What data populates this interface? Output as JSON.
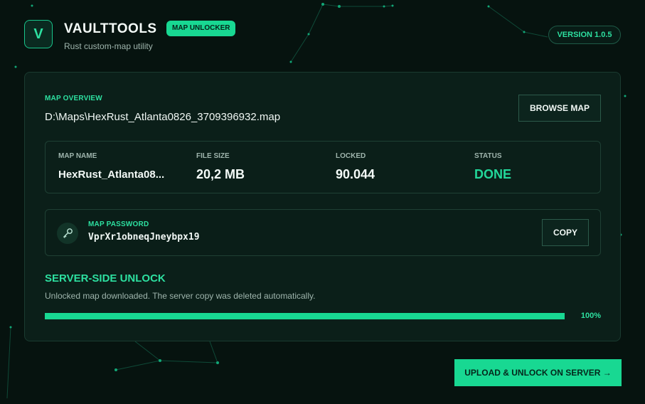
{
  "header": {
    "logo_letter": "V",
    "title": "VAULTTOOLS",
    "badge": "MAP UNLOCKER",
    "subtitle": "Rust custom-map utility",
    "version": "VERSION 1.0.5"
  },
  "overview": {
    "label": "MAP OVERVIEW",
    "path": "D:\\Maps\\HexRust_Atlanta0826_3709396932.map",
    "browse_label": "BROWSE MAP"
  },
  "stats": [
    {
      "label": "MAP NAME",
      "value": "HexRust_Atlanta08..."
    },
    {
      "label": "FILE SIZE",
      "value": "20,2 MB"
    },
    {
      "label": "LOCKED",
      "value": "90.044"
    },
    {
      "label": "STATUS",
      "value": "DONE"
    }
  ],
  "password": {
    "label": "MAP PASSWORD",
    "value": "VprXr1obneqJneybpx19",
    "copy_label": "COPY",
    "icon": "key-icon"
  },
  "unlock": {
    "title": "SERVER-SIDE UNLOCK",
    "description": "Unlocked map downloaded. The server copy was deleted automatically.",
    "progress_percent": 100,
    "progress_label": "100%"
  },
  "actions": {
    "upload_label": "UPLOAD & UNLOCK ON SERVER →"
  },
  "colors": {
    "accent": "#18d892",
    "background": "#06130f",
    "card": "#0b1f19"
  }
}
